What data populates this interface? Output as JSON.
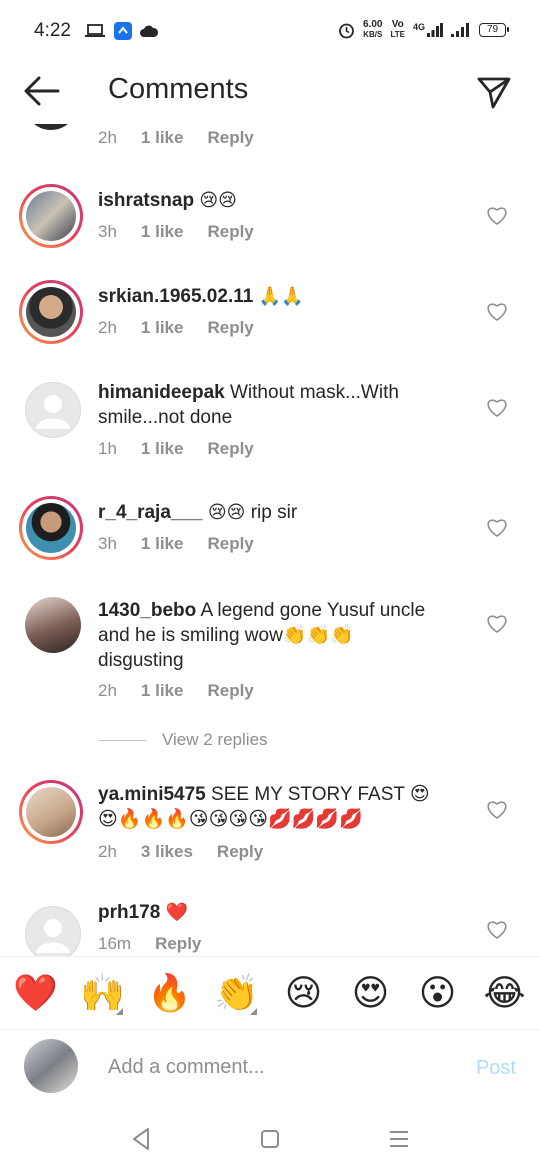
{
  "status_bar": {
    "time": "4:22",
    "net_speed_value": "6.00",
    "net_speed_unit": "KB/S",
    "volte_top": "Vo",
    "volte_bottom": "LTE",
    "signal_label": "4G",
    "battery": "79"
  },
  "header": {
    "title": "Comments",
    "back_icon": "arrow-left-icon",
    "share_icon": "paper-plane-icon"
  },
  "comments": [
    {
      "username": "",
      "text": "",
      "emoji": "",
      "time": "2h",
      "likes": "1 like",
      "reply": "Reply",
      "ring": false,
      "partial": true
    },
    {
      "username": "ishratsnap",
      "text": "",
      "emoji": "😢😢",
      "time": "3h",
      "likes": "1 like",
      "reply": "Reply",
      "ring": true
    },
    {
      "username": "srkian.1965.02.11",
      "text": "",
      "emoji": "🙏🙏",
      "time": "2h",
      "likes": "1 like",
      "reply": "Reply",
      "ring": true
    },
    {
      "username": "himanideepak",
      "text": "Without mask...With smile...not done",
      "emoji": "",
      "time": "1h",
      "likes": "1 like",
      "reply": "Reply",
      "ring": false
    },
    {
      "username": "r_4_raja___",
      "text": "rip sir",
      "emoji": "😢😢",
      "time": "3h",
      "likes": "1 like",
      "reply": "Reply",
      "ring": true
    },
    {
      "username": "1430_bebo",
      "text": "A legend gone Yusuf uncle and he is smiling wow👏👏👏 disgusting",
      "emoji": "",
      "time": "2h",
      "likes": "1 like",
      "reply": "Reply",
      "ring": false
    },
    {
      "username": "ya.mini5475",
      "text": "SEE MY STORY FAST 😍😍🔥🔥🔥😘😘😘😘💋💋💋💋",
      "emoji": "",
      "time": "2h",
      "likes": "3 likes",
      "reply": "Reply",
      "ring": true
    },
    {
      "username": "prh178",
      "text": "",
      "emoji": "❤️",
      "time": "16m",
      "likes": "",
      "reply": "Reply",
      "ring": false
    }
  ],
  "view_replies": "View 2 replies",
  "emoji_bar": [
    "❤️",
    "🙌",
    "🔥",
    "👏",
    "😢",
    "😍",
    "😮",
    "😂"
  ],
  "composer": {
    "placeholder": "Add a comment...",
    "post_label": "Post"
  },
  "colors": {
    "text": "#262626",
    "muted": "#8e8e8e",
    "post_disabled": "#b3dbff",
    "story_ring_start": "#f9a24b",
    "story_ring_end": "#c13584"
  }
}
